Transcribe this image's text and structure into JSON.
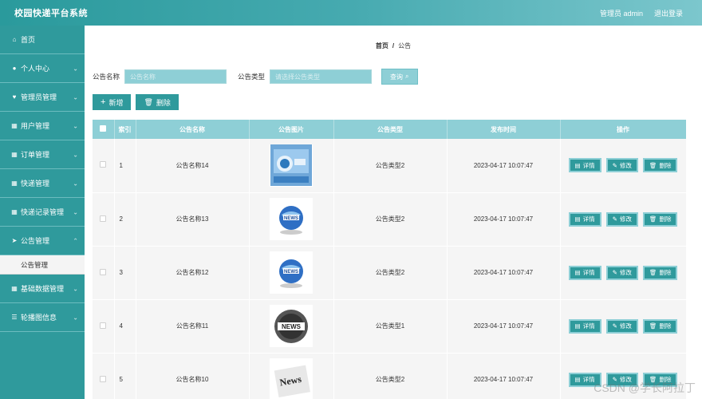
{
  "header": {
    "title": "校园快递平台系统",
    "user": "管理员 admin",
    "logout": "退出登录"
  },
  "sidebar": {
    "items": [
      {
        "label": "首页",
        "icon": "home-icon",
        "has_chevron": false
      },
      {
        "label": "个人中心",
        "icon": "user-icon",
        "has_chevron": true
      },
      {
        "label": "管理员管理",
        "icon": "heart-icon",
        "has_chevron": true
      },
      {
        "label": "用户管理",
        "icon": "grid-icon",
        "has_chevron": true
      },
      {
        "label": "订单管理",
        "icon": "grid-icon",
        "has_chevron": true
      },
      {
        "label": "快递管理",
        "icon": "grid-icon",
        "has_chevron": true
      },
      {
        "label": "快递记录管理",
        "icon": "grid-icon",
        "has_chevron": true
      },
      {
        "label": "公告管理",
        "icon": "send-icon",
        "has_chevron": true
      },
      {
        "label": "基础数据管理",
        "icon": "grid-icon",
        "has_chevron": true
      },
      {
        "label": "轮播图信息",
        "icon": "sliders-icon",
        "has_chevron": true
      }
    ],
    "submenu": {
      "label": "公告管理"
    }
  },
  "breadcrumb": {
    "home": "首页",
    "sep": "/",
    "current": "公告"
  },
  "search": {
    "name_label": "公告名称",
    "name_placeholder": "公告名称",
    "type_label": "公告类型",
    "type_placeholder": "请选择公告类型",
    "query_label": "查询"
  },
  "actions": {
    "add_label": "新增",
    "delete_label": "删除"
  },
  "table": {
    "columns": [
      "索引",
      "公告名称",
      "公告图片",
      "公告类型",
      "发布时间",
      "操作"
    ],
    "op_labels": {
      "detail": "详情",
      "edit": "修改",
      "delete": "删除"
    },
    "rows": [
      {
        "index": "1",
        "name": "公告名称14",
        "type": "公告类型2",
        "time": "2023-04-17 10:07:47",
        "image": "news-screen"
      },
      {
        "index": "2",
        "name": "公告名称13",
        "type": "公告类型2",
        "time": "2023-04-17 10:07:47",
        "image": "news-globe"
      },
      {
        "index": "3",
        "name": "公告名称12",
        "type": "公告类型2",
        "time": "2023-04-17 10:07:47",
        "image": "news-globe"
      },
      {
        "index": "4",
        "name": "公告名称11",
        "type": "公告类型1",
        "time": "2023-04-17 10:07:47",
        "image": "news-badge"
      },
      {
        "index": "5",
        "name": "公告名称10",
        "type": "公告类型2",
        "time": "2023-04-17 10:07:47",
        "image": "news-paper"
      }
    ]
  },
  "watermark": "CSDN @学长阿拉丁",
  "colors": {
    "primary": "#2f9a9c",
    "light": "#8ecfd6"
  }
}
